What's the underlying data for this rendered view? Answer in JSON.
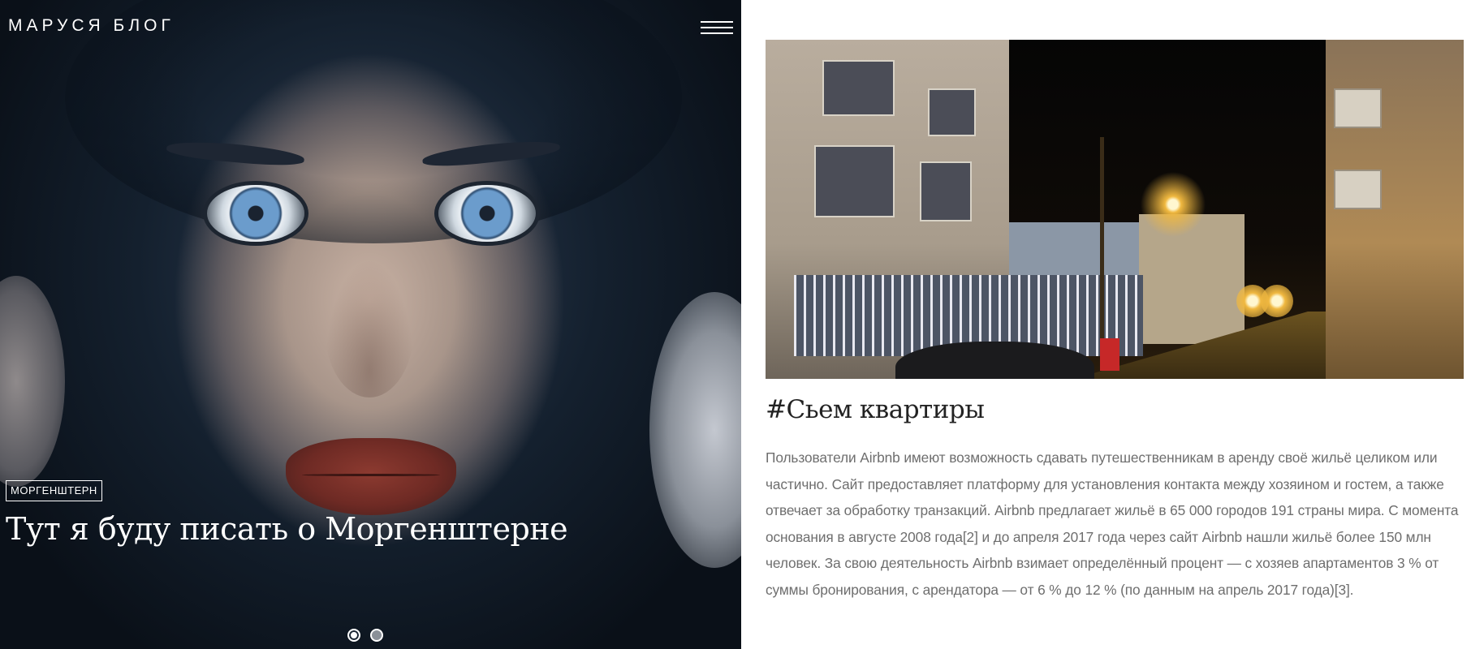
{
  "header": {
    "brand": "МАРУСЯ БЛОГ",
    "menu_icon": "hamburger-menu-icon"
  },
  "hero": {
    "tag": "МОРГЕНШТЕРН",
    "title": "Тут я буду писать о Моргенштерне",
    "slider": {
      "slide_count": 2,
      "active_index": 0
    }
  },
  "article": {
    "title": "#Сьем квартиры",
    "body": "Пользователи Airbnb имеют возможность сдавать путешественникам в аренду своё жильё целиком или частично. Сайт предоставляет платформу для установления контакта между хозяином и гостем, а также отвечает за обработку транзакций. Airbnb предлагает жильё в 65 000 городов 191 страны мира. С момента основания в августе 2008 года[2] и до апреля 2017 года через сайт Airbnb нашли жильё более 150 млн человек. За свою деятельность Airbnb взимает определённый процент — с хозяев апартаментов 3 % от суммы бронирования, с арендатора — от 6 % до 12 % (по данным на апрель 2017 года)[3]."
  },
  "colors": {
    "body_text": "#6e6e6e",
    "heading": "#222222",
    "hero_text": "#ffffff",
    "background": "#ffffff"
  }
}
